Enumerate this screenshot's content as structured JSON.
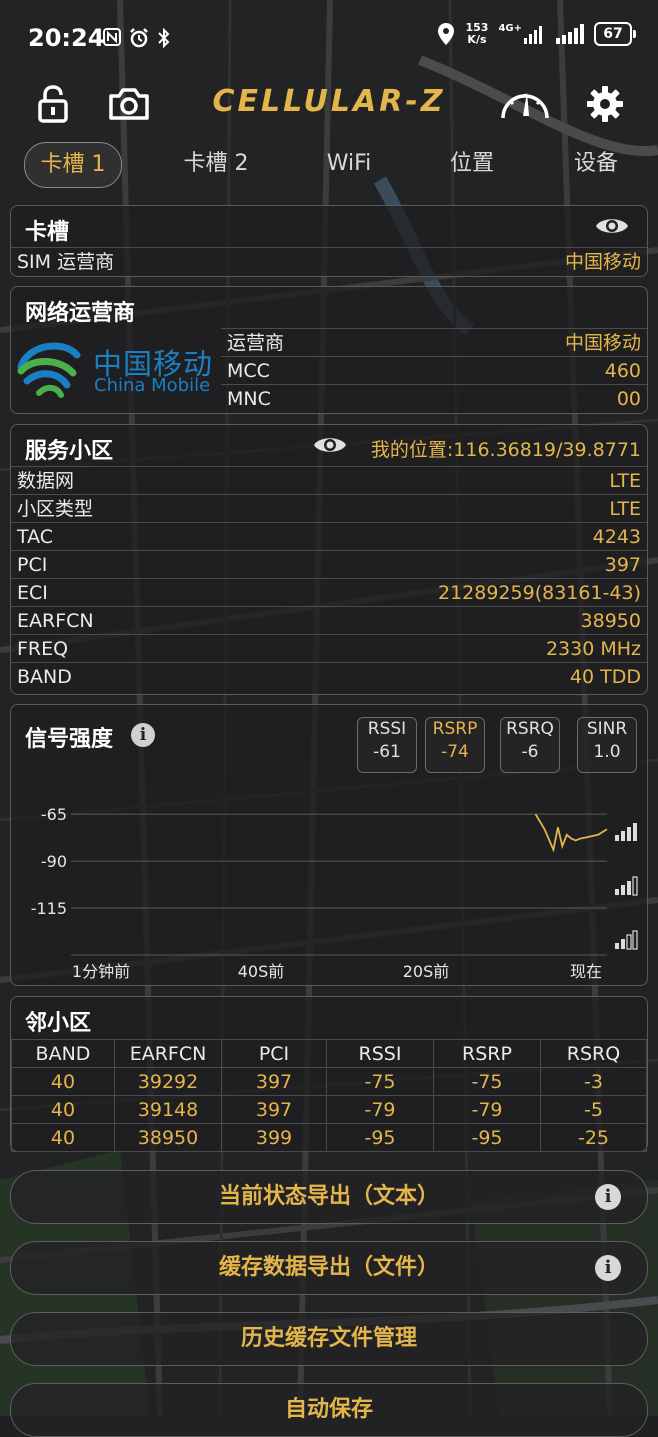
{
  "status_bar": {
    "time": "20:24",
    "net_speed_value": "153",
    "net_speed_unit": "K/s",
    "network_type": "4G+",
    "battery": "67"
  },
  "toolbar": {
    "brand": "CELLULAR-Z"
  },
  "tabs": [
    {
      "label": "卡槽 1",
      "active": true
    },
    {
      "label": "卡槽 2"
    },
    {
      "label": "WiFi"
    },
    {
      "label": "位置"
    },
    {
      "label": "设备"
    }
  ],
  "slot_card": {
    "title": "卡槽",
    "sim_label": "SIM 运营商",
    "sim_value": "中国移动"
  },
  "operator_card": {
    "title": "网络运营商",
    "logo_cn": "中国移动",
    "logo_en": "China Mobile",
    "rows": [
      {
        "k": "运营商",
        "v": "中国移动"
      },
      {
        "k": "MCC",
        "v": "460"
      },
      {
        "k": "MNC",
        "v": "00"
      }
    ]
  },
  "service_card": {
    "title": "服务小区",
    "location": "我的位置:116.36819/39.8771",
    "rows": [
      {
        "k": "数据网",
        "v": "LTE"
      },
      {
        "k": "小区类型",
        "v": "LTE"
      },
      {
        "k": "TAC",
        "v": "4243"
      },
      {
        "k": "PCI",
        "v": "397"
      },
      {
        "k": "ECI",
        "v": "21289259(83161-43)"
      },
      {
        "k": "EARFCN",
        "v": "38950"
      },
      {
        "k": "FREQ",
        "v": "2330 MHz"
      },
      {
        "k": "BAND",
        "v": "40 TDD"
      }
    ]
  },
  "signal_card": {
    "title": "信号强度",
    "badges": [
      {
        "name": "RSSI",
        "value": "-61"
      },
      {
        "name": "RSRP",
        "value": "-74",
        "selected": true
      },
      {
        "name": "RSRQ",
        "value": "-6"
      },
      {
        "name": "SINR",
        "value": "1.0"
      }
    ]
  },
  "chart_data": {
    "type": "line",
    "y_ticks": [
      "-65",
      "-90",
      "-115"
    ],
    "x_ticks": [
      "1分钟前",
      "40S前",
      "20S前",
      "现在"
    ],
    "ylim": [
      -140,
      -58
    ],
    "x": [
      -8,
      -7,
      -6,
      -5.5,
      -5,
      -4.5,
      -4,
      -3.5,
      -3,
      -2,
      -1,
      0
    ],
    "series": [
      {
        "values": [
          -65,
          -73,
          -84,
          -72,
          -82,
          -76,
          -78,
          -79,
          -78,
          -77,
          -76,
          -73
        ]
      }
    ],
    "line_color": "#e3b54a",
    "grid": true
  },
  "neighbor_card": {
    "title": "邻小区",
    "headers": [
      "BAND",
      "EARFCN",
      "PCI",
      "RSSI",
      "RSRP",
      "RSRQ"
    ],
    "rows": [
      [
        "40",
        "39292",
        "397",
        "-75",
        "-75",
        "-3"
      ],
      [
        "40",
        "39148",
        "397",
        "-79",
        "-79",
        "-5"
      ],
      [
        "40",
        "38950",
        "399",
        "-95",
        "-95",
        "-25"
      ]
    ]
  },
  "buttons": {
    "export_text": "当前状态导出（文本）",
    "export_file": "缓存数据导出（文件）",
    "history": "历史缓存文件管理",
    "autosave": "自动保存",
    "info_glyph": "i"
  }
}
